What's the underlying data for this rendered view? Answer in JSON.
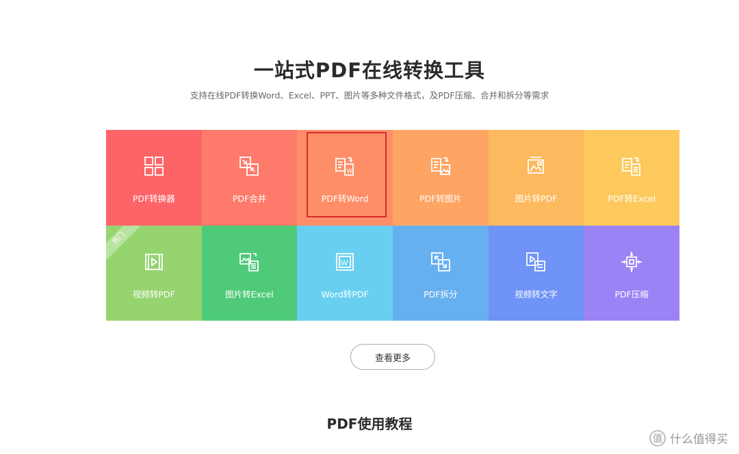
{
  "header": {
    "title": "一站式PDF在线转换工具",
    "subtitle": "支持在线PDF转换Word、Excel、PPT、图片等多种文件格式，及PDF压缩、合并和拆分等需求"
  },
  "tools": [
    {
      "label": "PDF转换器",
      "icon": "grid-icon",
      "color": "#fd6468"
    },
    {
      "label": "PDF合并",
      "icon": "merge-icon",
      "color": "#fe7b6b"
    },
    {
      "label": "PDF转Word",
      "icon": "pdf-to-word-icon",
      "color": "#fe8e68",
      "selected": true
    },
    {
      "label": "PDF转图片",
      "icon": "pdf-to-image-icon",
      "color": "#fea564"
    },
    {
      "label": "图片转PDF",
      "icon": "image-to-pdf-icon",
      "color": "#fdb95e"
    },
    {
      "label": "PDF转Excel",
      "icon": "pdf-to-excel-icon",
      "color": "#fdc95c"
    },
    {
      "label": "视频转PDF",
      "icon": "video-to-pdf-icon",
      "color": "#95d46f",
      "badge": "热门"
    },
    {
      "label": "图片转Excel",
      "icon": "image-to-excel-icon",
      "color": "#4fca78"
    },
    {
      "label": "Word转PDF",
      "icon": "word-to-pdf-icon",
      "color": "#69cff0"
    },
    {
      "label": "PDF拆分",
      "icon": "split-icon",
      "color": "#67b0ef"
    },
    {
      "label": "视频转文字",
      "icon": "video-to-text-icon",
      "color": "#6f93f6"
    },
    {
      "label": "PDF压缩",
      "icon": "compress-icon",
      "color": "#9b82f5"
    }
  ],
  "more_button": "查看更多",
  "section_title": "PDF使用教程",
  "watermark": {
    "logo": "值",
    "text": "什么值得买"
  }
}
